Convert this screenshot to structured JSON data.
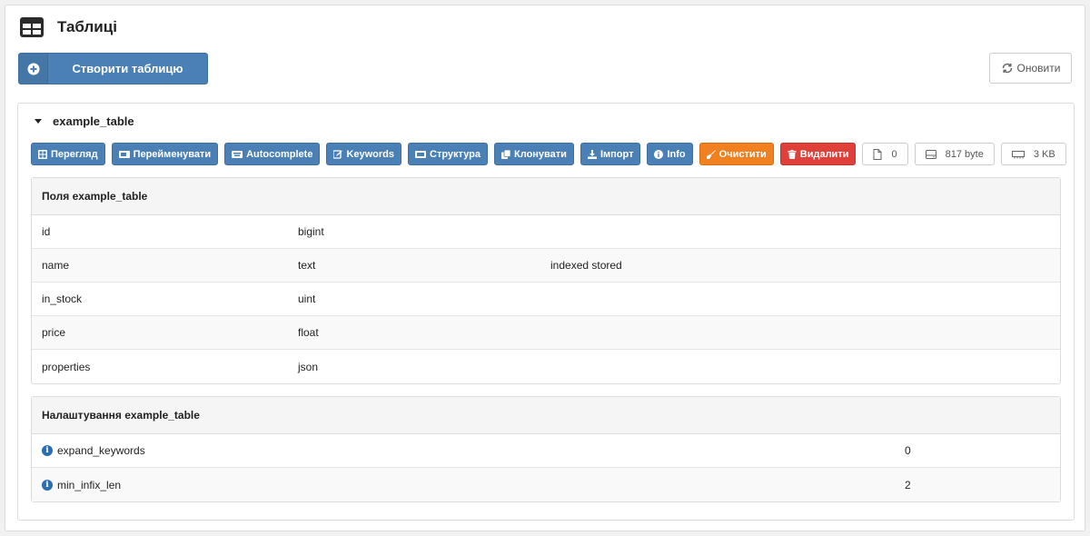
{
  "header": {
    "title": "Таблиці"
  },
  "actions": {
    "create_label": "Створити таблицю",
    "refresh_label": "Оновити"
  },
  "table": {
    "name": "example_table",
    "toolbar": [
      {
        "key": "view",
        "label": "Перегляд",
        "icon": "grid-icon",
        "style": "blue"
      },
      {
        "key": "rename",
        "label": "Перейменувати",
        "icon": "rename-icon",
        "style": "blue"
      },
      {
        "key": "autocomplete",
        "label": "Autocomplete",
        "icon": "keyboard-icon",
        "style": "blue"
      },
      {
        "key": "keywords",
        "label": "Keywords",
        "icon": "edit-icon",
        "style": "blue"
      },
      {
        "key": "structure",
        "label": "Структура",
        "icon": "structure-icon",
        "style": "blue"
      },
      {
        "key": "clone",
        "label": "Клонувати",
        "icon": "copy-icon",
        "style": "blue"
      },
      {
        "key": "import",
        "label": "Імпорт",
        "icon": "download-icon",
        "style": "blue"
      },
      {
        "key": "info",
        "label": "Info",
        "icon": "info-icon",
        "style": "blue"
      },
      {
        "key": "clear",
        "label": "Очистити",
        "icon": "broom-icon",
        "style": "orange"
      },
      {
        "key": "delete",
        "label": "Видалити",
        "icon": "trash-icon",
        "style": "red"
      }
    ],
    "stats": [
      {
        "key": "docs",
        "value": "0",
        "icon": "file-icon"
      },
      {
        "key": "size",
        "value": "817 byte",
        "icon": "hdd-icon"
      },
      {
        "key": "memory",
        "value": "3 KB",
        "icon": "memory-icon"
      }
    ],
    "fields_title": "Поля example_table",
    "fields": [
      {
        "name": "id",
        "type": "bigint",
        "props": ""
      },
      {
        "name": "name",
        "type": "text",
        "props": "indexed stored"
      },
      {
        "name": "in_stock",
        "type": "uint",
        "props": ""
      },
      {
        "name": "price",
        "type": "float",
        "props": ""
      },
      {
        "name": "properties",
        "type": "json",
        "props": ""
      }
    ],
    "settings_title": "Налаштування example_table",
    "settings": [
      {
        "name": "expand_keywords",
        "value": "0"
      },
      {
        "name": "min_infix_len",
        "value": "2"
      }
    ]
  },
  "colors": {
    "primary": "#4a80b5",
    "warning": "#f08020",
    "danger": "#e0403a"
  }
}
